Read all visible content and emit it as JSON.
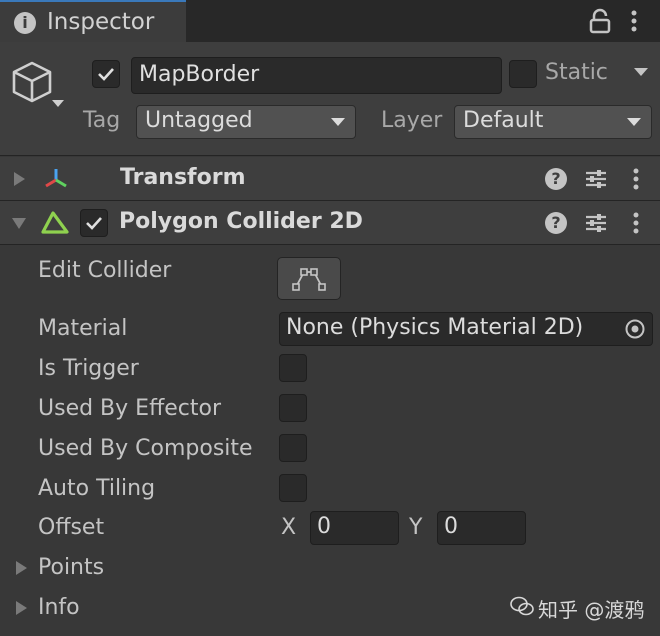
{
  "tab": {
    "label": "Inspector",
    "info_glyph": "i",
    "icons": [
      "lock-icon",
      "kebab-menu-icon"
    ]
  },
  "gameobject": {
    "active": true,
    "name": "MapBorder",
    "static_label": "Static",
    "static_checked": false,
    "tag_label": "Tag",
    "tag_value": "Untagged",
    "layer_label": "Layer",
    "layer_value": "Default",
    "icon": "cube-icon"
  },
  "components": {
    "transform": {
      "title": "Transform",
      "expanded": false,
      "icon": "transform-axes-icon"
    },
    "collider": {
      "title": "Polygon Collider 2D",
      "enabled": true,
      "expanded": true,
      "icon": "polygon-collider-icon",
      "help_glyph": "?",
      "edit_collider_label": "Edit Collider",
      "material_label": "Material",
      "material_value": "None (Physics Material 2D)",
      "is_trigger_label": "Is Trigger",
      "is_trigger": false,
      "used_by_effector_label": "Used By Effector",
      "used_by_effector": false,
      "used_by_composite_label": "Used By Composite",
      "used_by_composite": false,
      "auto_tiling_label": "Auto Tiling",
      "auto_tiling": false,
      "offset_label": "Offset",
      "offset_x_label": "X",
      "offset_x": "0",
      "offset_y_label": "Y",
      "offset_y": "0",
      "points_label": "Points",
      "info_label": "Info"
    }
  },
  "watermark": "知乎 @渡鸦",
  "colors": {
    "accent_tab": "#3a79bb",
    "transform_icon": [
      "#e04848",
      "#5fd15f",
      "#4aa3f0"
    ],
    "collider_icon": "#8fd14f"
  }
}
